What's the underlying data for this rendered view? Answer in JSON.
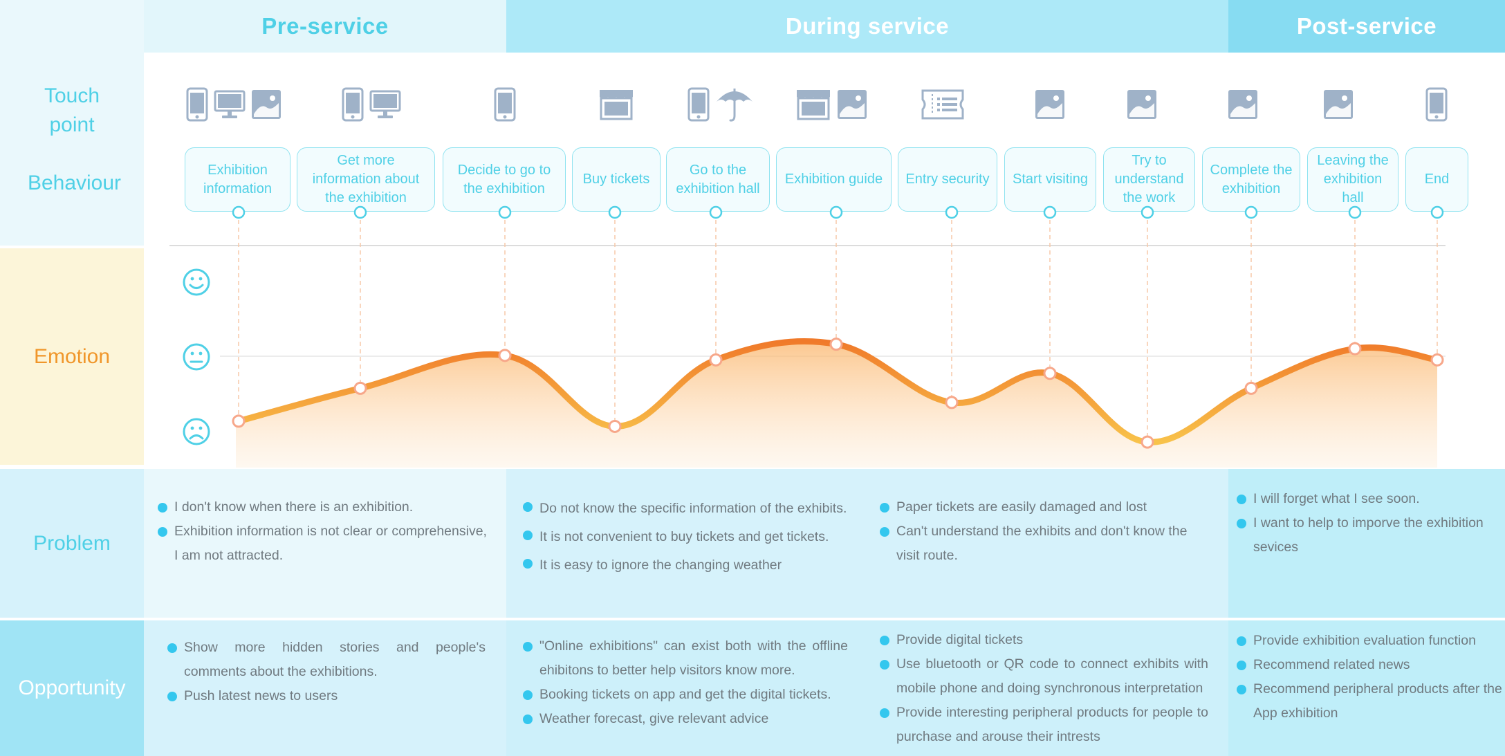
{
  "phases": [
    {
      "label": "Pre-service"
    },
    {
      "label": "During service"
    },
    {
      "label": "Post-service"
    }
  ],
  "row_labels": {
    "touch_point": "Touch\npoint",
    "behaviour": "Behaviour",
    "emotion": "Emotion",
    "problem": "Problem",
    "opportunity": "Opportunity"
  },
  "colors": {
    "accent_cyan": "#4fd0e6",
    "emotion_orange": "#f28a2e",
    "emotion_label": "#f0962a",
    "icon_gray": "#9fb2c8",
    "bullet": "#34c7ee"
  },
  "touchpoints": [
    [
      "phone-icon",
      "monitor-icon",
      "picture-icon"
    ],
    [
      "phone-icon",
      "monitor-icon"
    ],
    [
      "phone-icon"
    ],
    [
      "shop-icon"
    ],
    [
      "phone-icon",
      "umbrella-icon"
    ],
    [
      "shop-icon",
      "picture-icon"
    ],
    [
      "ticket-icon"
    ],
    [
      "picture-icon"
    ],
    [
      "picture-icon"
    ],
    [
      "picture-icon"
    ],
    [
      "picture-icon"
    ],
    [
      "phone-icon"
    ]
  ],
  "behaviours": [
    "Exhibition information",
    "Get more information about the exhibition",
    "Decide to go to the exhibition",
    "Buy tickets",
    "Go to the exhibition hall",
    "Exhibition guide",
    "Entry security",
    "Start visiting",
    "Try to understand the work",
    "Complete the exhibition",
    "Leaving the exhibition hall",
    "End"
  ],
  "emotion_levels": [
    "happy-face-icon",
    "neutral-face-icon",
    "sad-face-icon"
  ],
  "emotion_values": [
    0.14,
    0.58,
    1.02,
    0.07,
    0.96,
    1.17,
    0.39,
    0.78,
    -0.14,
    0.58,
    1.11,
    0.96
  ],
  "problems": {
    "pre": [
      "I don't know when there is an exhibition.",
      "Exhibition information is not clear or comprehensive, I am not attracted."
    ],
    "during_a": [
      "Do not know the specific information of the exhibits.",
      "It is not convenient to buy tickets and get tickets.",
      "It is easy to ignore the changing weather"
    ],
    "during_b": [
      "Paper tickets are easily damaged and  lost",
      "Can't understand the exhibits and don't know the visit route."
    ],
    "post": [
      "I will forget what I see soon.",
      "I want to help to imporve the exhibition sevices"
    ]
  },
  "opportunities": {
    "pre": [
      "Show more hidden stories and people's comments about the exhibitions.",
      "Push latest news to users"
    ],
    "during_a": [
      "\"Online exhibitions\" can exist both with the offline ehibitons to better help visitors know more.",
      "Booking tickets on app and get the digital tickets.",
      "Weather forecast, give relevant advice"
    ],
    "during_b": [
      "Provide digital tickets",
      "Use bluetooth or QR code to connect exhibits with mobile phone and doing synchronous interpretation",
      "Provide interesting peripheral products for people to purchase and arouse their intrests"
    ],
    "post": [
      "Provide exhibition evaluation function",
      "Recommend related news",
      "Recommend peripheral products after the App exhibition"
    ]
  }
}
